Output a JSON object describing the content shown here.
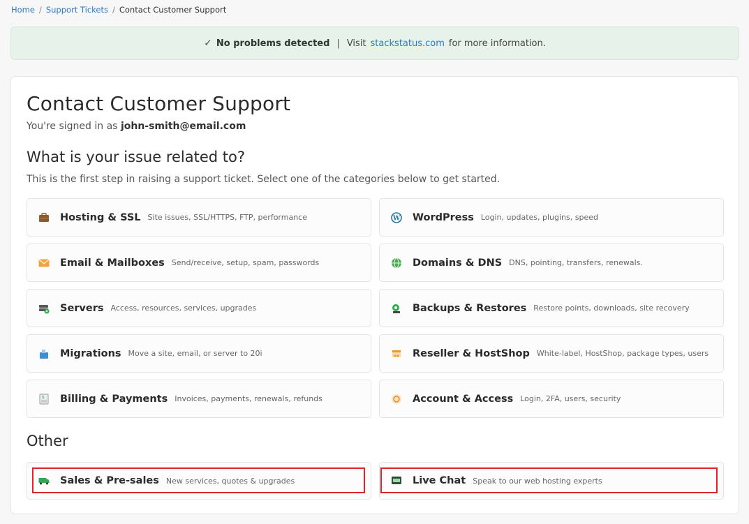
{
  "breadcrumb": {
    "home": "Home",
    "sep1": "/",
    "tickets": "Support Tickets",
    "sep2": "/",
    "current": "Contact Customer Support"
  },
  "status": {
    "check": "✓",
    "message": "No problems detected",
    "pipe": "|",
    "visit": "Visit",
    "link": "stackstatus.com",
    "suffix": "for more information."
  },
  "page": {
    "title": "Contact Customer Support",
    "signed_in_prefix": "You're signed in as",
    "email": "john-smith@email.com",
    "issue_heading": "What is your issue related to?",
    "intro": "This is the first step in raising a support ticket. Select one of the categories below to get started.",
    "other_heading": "Other"
  },
  "categories": [
    {
      "name": "Hosting & SSL",
      "desc": "Site issues, SSL/HTTPS, FTP, performance",
      "icon": "briefcase-icon"
    },
    {
      "name": "WordPress",
      "desc": "Login, updates, plugins, speed",
      "icon": "wordpress-icon"
    },
    {
      "name": "Email & Mailboxes",
      "desc": "Send/receive, setup, spam, passwords",
      "icon": "envelope-icon"
    },
    {
      "name": "Domains & DNS",
      "desc": "DNS, pointing, transfers, renewals.",
      "icon": "globe-icon"
    },
    {
      "name": "Servers",
      "desc": "Access, resources, services, upgrades",
      "icon": "server-icon"
    },
    {
      "name": "Backups & Restores",
      "desc": "Restore points, downloads, site recovery",
      "icon": "backup-icon"
    },
    {
      "name": "Migrations",
      "desc": "Move a site, email, or server to 20i",
      "icon": "migration-icon"
    },
    {
      "name": "Reseller & HostShop",
      "desc": "White-label, HostShop, package types, users",
      "icon": "reseller-icon"
    },
    {
      "name": "Billing & Payments",
      "desc": "Invoices, payments, renewals, refunds",
      "icon": "invoice-icon"
    },
    {
      "name": "Account & Access",
      "desc": "Login, 2FA, users, security",
      "icon": "account-icon"
    }
  ],
  "other": [
    {
      "name": "Sales & Pre-sales",
      "desc": "New services, quotes & upgrades",
      "icon": "sales-icon"
    },
    {
      "name": "Live Chat",
      "desc": "Speak to our web hosting experts",
      "icon": "chat-icon"
    }
  ],
  "colors": {
    "link": "#2a7ac6",
    "status_bg": "#e6f2ea",
    "highlight": "#d9262c"
  }
}
